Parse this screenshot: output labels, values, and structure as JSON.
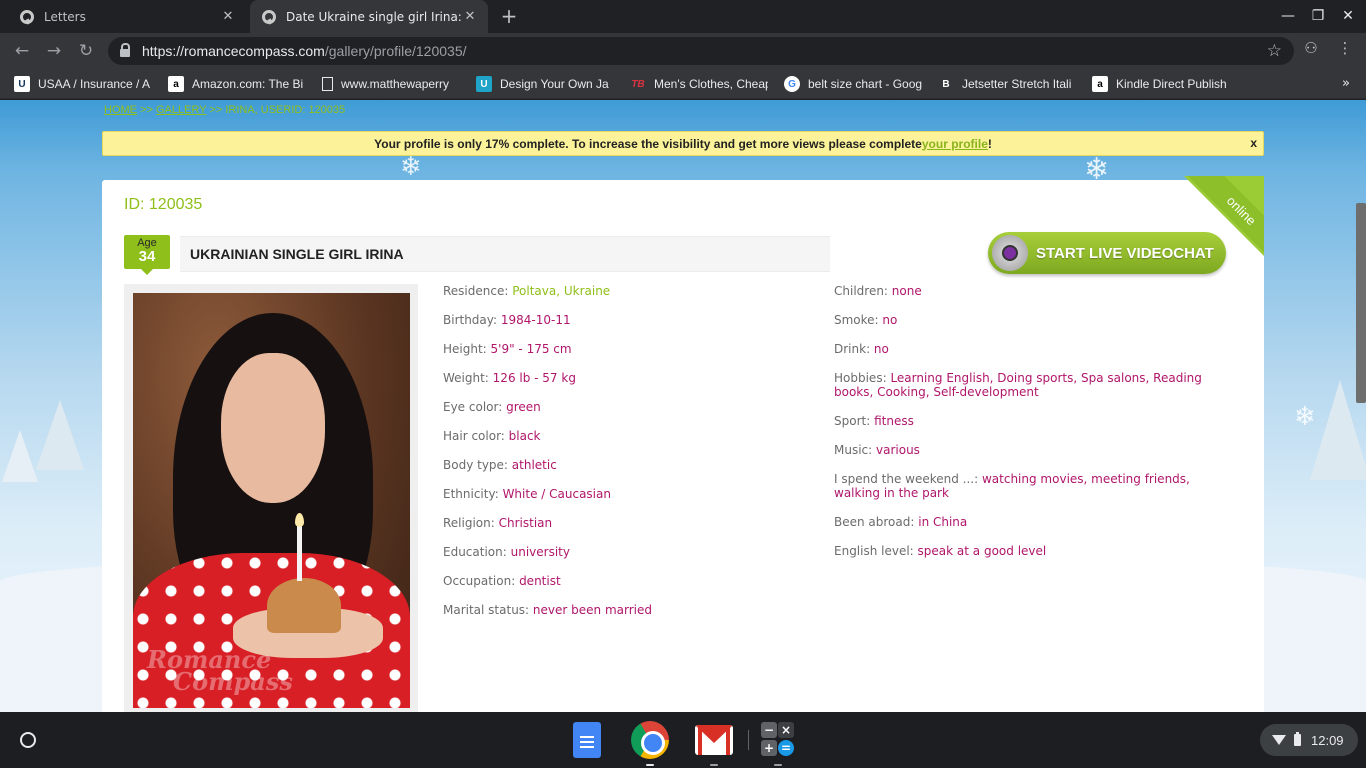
{
  "browser": {
    "tabs": [
      {
        "title": "Letters",
        "active": false
      },
      {
        "title": "Date Ukraine single girl Irina: gre",
        "active": true
      }
    ],
    "url_host": "https://romancecompass.com",
    "url_path": "/gallery/profile/120035/",
    "bookmarks": [
      {
        "label": "USAA / Insurance / A",
        "icon": "usaa-icon"
      },
      {
        "label": "Amazon.com: The Bi",
        "icon": "amazon-icon"
      },
      {
        "label": "www.matthewaperry",
        "icon": "page-icon"
      },
      {
        "label": "Design Your Own Ja",
        "icon": "design-icon"
      },
      {
        "label": "Men's Clothes, Cheap",
        "icon": "tb-icon"
      },
      {
        "label": "belt size chart - Goog",
        "icon": "google-icon"
      },
      {
        "label": "Jetsetter Stretch Itali",
        "icon": "b-icon"
      },
      {
        "label": "Kindle Direct Publish",
        "icon": "amazon-icon"
      }
    ]
  },
  "page": {
    "breadcrumb": {
      "home": "HOME",
      "gallery": "GALLERY",
      "sep": ">>",
      "current": "IRINA, USERID: 120035"
    },
    "notice": {
      "text_before": "Your profile is only 17% complete. To increase the visibility and get more views please complete ",
      "link": "your profile",
      "text_after": "!",
      "close": "x",
      "profile_complete_pct": 17
    },
    "profile": {
      "id_label": "ID: 120035",
      "online_label": "online",
      "age_label": "Age",
      "age_value": "34",
      "name": "UKRAINIAN SINGLE GIRL IRINA",
      "videochat_label": "START LIVE VIDEOCHAT",
      "photo_watermark_1": "Romance",
      "photo_watermark_2": "Compass"
    },
    "details_left": [
      {
        "key": "Residence: ",
        "value": "Poltava, Ukraine",
        "style": "green"
      },
      {
        "key": "Birthday: ",
        "value": "1984-10-11"
      },
      {
        "key": "Height: ",
        "value": "5'9\" - 175 cm"
      },
      {
        "key": "Weight: ",
        "value": "126 lb - 57 kg"
      },
      {
        "key": "Eye color: ",
        "value": "green"
      },
      {
        "key": "Hair color: ",
        "value": "black"
      },
      {
        "key": "Body type: ",
        "value": "athletic"
      },
      {
        "key": "Ethnicity: ",
        "value": "White / Caucasian"
      },
      {
        "key": "Religion: ",
        "value": "Christian"
      },
      {
        "key": "Education: ",
        "value": "university"
      },
      {
        "key": "Occupation: ",
        "value": "dentist"
      },
      {
        "key": "Marital status: ",
        "value": "never been married"
      }
    ],
    "details_right": [
      {
        "key": "Children: ",
        "value": "none"
      },
      {
        "key": "Smoke: ",
        "value": "no"
      },
      {
        "key": "Drink: ",
        "value": "no"
      },
      {
        "key": "Hobbies: ",
        "value": "Learning English, Doing sports, Spa salons, Reading books, Cooking, Self-development"
      },
      {
        "key": "Sport: ",
        "value": "fitness"
      },
      {
        "key": "Music: ",
        "value": "various"
      },
      {
        "key": "I spend the weekend ...: ",
        "value": "watching movies, meeting friends, walking in the park"
      },
      {
        "key": "Been abroad: ",
        "value": "in China"
      },
      {
        "key": "English level: ",
        "value": "speak at a good level"
      }
    ]
  },
  "shelf": {
    "apps": [
      "google-docs-icon",
      "chrome-icon",
      "gmail-icon",
      "calculator-icon"
    ],
    "time": "12:09"
  },
  "colors": {
    "accent_green": "#8fbf1a",
    "value_magenta": "#b0166a",
    "notice_yellow": "#fbf29a"
  }
}
